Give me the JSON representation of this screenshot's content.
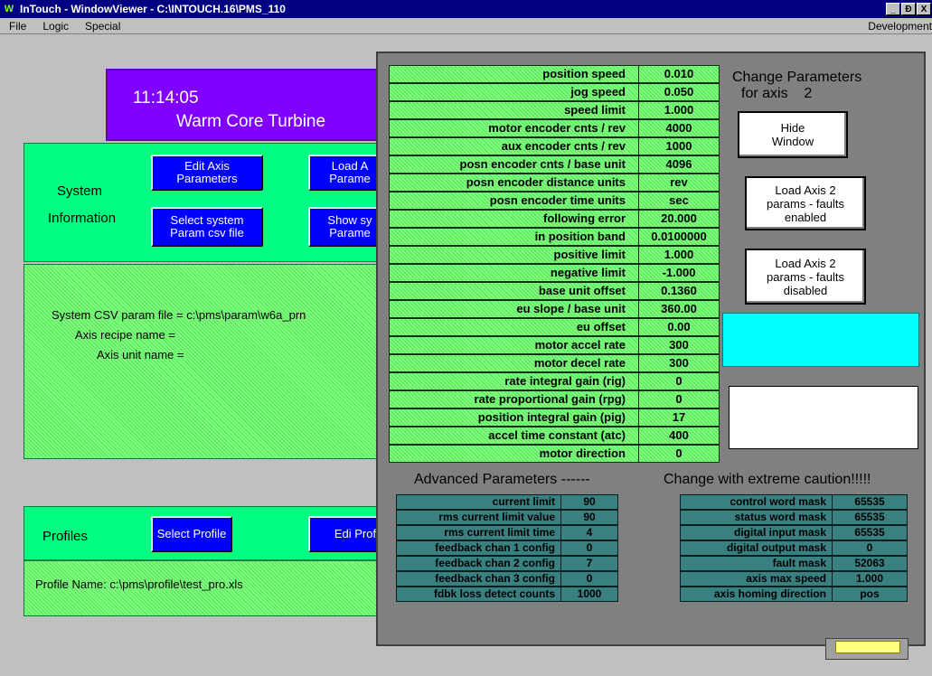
{
  "window": {
    "title": "InTouch - WindowViewer - C:\\INTOUCH.16\\PMS_110",
    "minimize": "_",
    "restore": "Ɖ",
    "close": "X"
  },
  "menu": {
    "items": [
      "File",
      "Logic",
      "Special"
    ],
    "right": "Development"
  },
  "banner": {
    "time": "11:14:05",
    "name": "Warm Core Turbine"
  },
  "system": {
    "label1": "System",
    "label2": "Information",
    "edit_axis": "Edit Axis Parameters",
    "load_axis": "Load A Parame",
    "select_csv": "Select system Param csv file",
    "show_sys": "Show sy Parame"
  },
  "csv": {
    "file": "System CSV param file = c:\\pms\\param\\w6a_prn",
    "recipe": "Axis recipe name =",
    "unit": "Axis unit name ="
  },
  "profiles": {
    "label": "Profiles",
    "select": "Select Profile",
    "edit": "Edi Profi",
    "name": "Profile Name:   c:\\pms\\profile\\test_pro.xls"
  },
  "popup": {
    "change_title": "Change Parameters",
    "for_axis": "for axis",
    "axis_num": "2",
    "hide": "Hide Window",
    "load_enabled": "Load Axis 2 params - faults enabled",
    "load_disabled": "Load Axis 2 params - faults disabled",
    "params": [
      {
        "label": "position speed",
        "value": "0.010"
      },
      {
        "label": "jog speed",
        "value": "0.050"
      },
      {
        "label": "speed limit",
        "value": "1.000"
      },
      {
        "label": "motor encoder cnts / rev",
        "value": "4000"
      },
      {
        "label": "aux encoder cnts / rev",
        "value": "1000"
      },
      {
        "label": "posn encoder cnts / base unit",
        "value": "4096"
      },
      {
        "label": "posn encoder distance units",
        "value": "rev"
      },
      {
        "label": "posn encoder time units",
        "value": "sec"
      },
      {
        "label": "following error",
        "value": "20.000"
      },
      {
        "label": "in position band",
        "value": "0.0100000"
      },
      {
        "label": "positive limit",
        "value": "1.000"
      },
      {
        "label": "negative limit",
        "value": "-1.000"
      },
      {
        "label": "base unit offset",
        "value": "0.1360"
      },
      {
        "label": "eu slope / base unit",
        "value": "360.00"
      },
      {
        "label": "eu offset",
        "value": "0.00"
      },
      {
        "label": "motor accel rate",
        "value": "300"
      },
      {
        "label": "motor decel rate",
        "value": "300"
      },
      {
        "label": "rate integral gain (rig)",
        "value": "0"
      },
      {
        "label": "rate proportional gain (rpg)",
        "value": "0"
      },
      {
        "label": "position integral gain (pig)",
        "value": "17"
      },
      {
        "label": "accel time constant (atc)",
        "value": "400"
      },
      {
        "label": "motor direction",
        "value": "0"
      }
    ],
    "adv_title": "Advanced Parameters  ------",
    "caution_title": "Change with extreme caution!!!!!",
    "adv_left": [
      {
        "label": "current limit",
        "value": "90"
      },
      {
        "label": "rms current limit value",
        "value": "90"
      },
      {
        "label": "rms current limit time",
        "value": "4"
      },
      {
        "label": "feedback chan 1 config",
        "value": "0"
      },
      {
        "label": "feedback chan 2 config",
        "value": "7"
      },
      {
        "label": "feedback chan 3 config",
        "value": "0"
      },
      {
        "label": "fdbk loss detect counts",
        "value": "1000"
      }
    ],
    "adv_right": [
      {
        "label": "control word mask",
        "value": "65535"
      },
      {
        "label": "status word mask",
        "value": "65535"
      },
      {
        "label": "digital input mask",
        "value": "65535"
      },
      {
        "label": "digital output mask",
        "value": "0"
      },
      {
        "label": "fault mask",
        "value": "52063"
      },
      {
        "label": "axis max speed",
        "value": "1.000"
      },
      {
        "label": "axis homing direction",
        "value": "pos"
      }
    ]
  }
}
